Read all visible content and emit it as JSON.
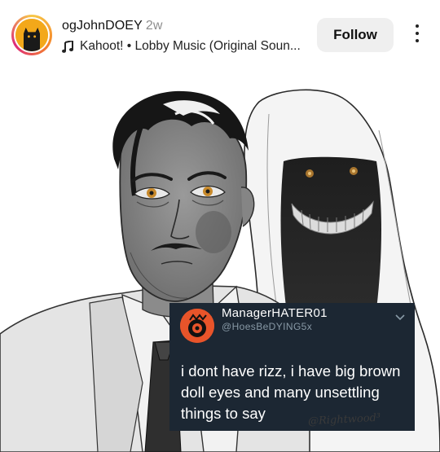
{
  "post": {
    "username": "ogJohnDOEY",
    "time_ago": "2w",
    "music": "Kahoot! • Lobby Music (Original Soun...",
    "follow_label": "Follow",
    "more_icon": "more-vertical-icon",
    "music_icon": "music-note-icon"
  },
  "tweet": {
    "display_name": "ManagerHATER01",
    "handle": "@HoesBeDYING5x",
    "text": "i dont have rizz, i have big brown doll eyes and many unsettling things to say",
    "chevron_icon": "chevron-down-icon"
  },
  "artwork": {
    "signature": "@Rightwood³"
  },
  "colors": {
    "tweet_bg": "#1c2733",
    "follow_bg": "#efefef",
    "avatar_ring": "#f58529"
  }
}
